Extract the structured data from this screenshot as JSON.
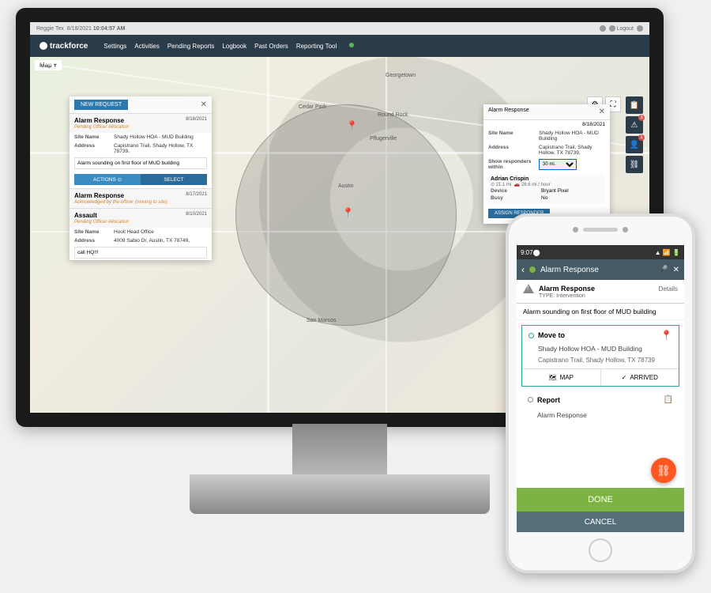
{
  "statusbar": {
    "user": "Reggie Tex",
    "date": "8/18/2021",
    "time": "10:04:57 AM",
    "logout": "Logout"
  },
  "brand": "trackforce",
  "nav": [
    "Settings",
    "Activities",
    "Pending Reports",
    "Logbook",
    "Past Orders",
    "Reporting Tool"
  ],
  "map_label": "Map",
  "cities": {
    "austin": "Austin",
    "roundrock": "Round Rock",
    "georgetown": "Georgetown",
    "sanmarcos": "San Marcos",
    "cedarpark": "Cedar Park",
    "pflugerville": "Pflugerville"
  },
  "left": {
    "new_btn": "NEW REQUEST",
    "items": [
      {
        "title": "Alarm Response",
        "status": "Pending Officer Allocation",
        "date": "8/18/2021",
        "site_lbl": "Site Name",
        "site": "Shady Hollow HOA - MUD Building",
        "addr_lbl": "Address",
        "addr": "Capistrano Trail, Shady Hollow, TX 78739,",
        "note": "Alarm sounding on first floor of MUD building",
        "act": "ACTIONS ⊙",
        "sel": "SELECT"
      },
      {
        "title": "Alarm Response",
        "status": "Acknowledged by the officer (moving to site)",
        "date": "8/17/2021"
      },
      {
        "title": "Assault",
        "status": "Pending Officer Allocation",
        "date": "8/10/2021",
        "site_lbl": "Site Name",
        "site": "Hooli Head Office",
        "addr_lbl": "Address",
        "addr": "4009 Sabio Dr, Austin, TX 78749,",
        "note": "call HQ!!!"
      }
    ]
  },
  "right": {
    "title": "Alarm Response",
    "date": "8/18/2021",
    "site_lbl": "Site Name",
    "site": "Shady Hollow HOA - MUD Building",
    "addr_lbl": "Address",
    "addr": "Capistrano Trail, Shady Hollow, TX 78739,",
    "resp_lbl": "Show responders within",
    "resp_val": "30 mi.",
    "responder": {
      "name": "Adrian Crispin",
      "time": "21.1 mi",
      "speed": "28.6 mi / hour",
      "dev_lbl": "Device",
      "device": "Bryant Pixel",
      "busy_lbl": "Busy",
      "busy": "No"
    },
    "assign": "ASSIGN RESPONDER"
  },
  "phone": {
    "time": "9:07",
    "header": "Alarm Response",
    "alarm_title": "Alarm Response",
    "alarm_type": "TYPE: Intervention",
    "details": "Details",
    "desc": "Alarm sounding on first floor of MUD building",
    "move": "Move to",
    "move_site": "Shady Hollow HOA - MUD Building",
    "move_addr": "Capistrano Trail, Shady Hollow, TX 78739",
    "map_btn": "MAP",
    "arrived_btn": "ARRIVED",
    "report": "Report",
    "report_sub": "Alarm Response",
    "done": "DONE",
    "cancel": "CANCEL"
  }
}
